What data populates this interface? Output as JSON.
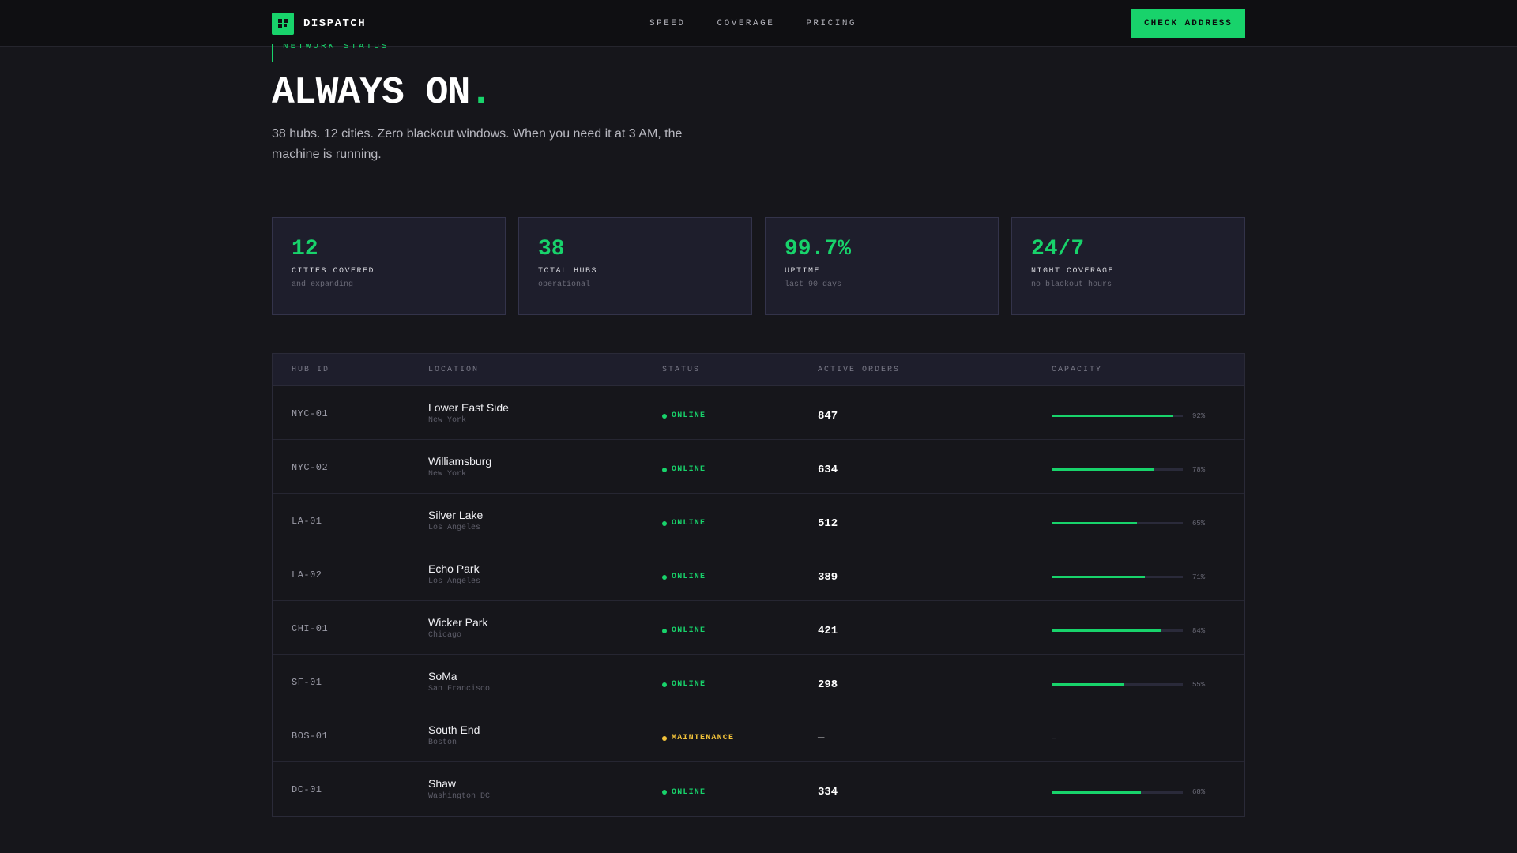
{
  "nav": {
    "brand": "DISPATCH",
    "links": [
      "SPEED",
      "COVERAGE",
      "PRICING"
    ],
    "cta": "CHECK ADDRESS"
  },
  "hero": {
    "eyebrow": "NETWORK STATUS",
    "title": "ALWAYS ON",
    "title_dot": ".",
    "subtitle": "38 hubs. 12 cities. Zero blackout windows. When you need it at 3 AM, the machine is running."
  },
  "stats": [
    {
      "value": "12",
      "label": "CITIES COVERED",
      "sub": "and expanding"
    },
    {
      "value": "38",
      "label": "TOTAL HUBS",
      "sub": "operational"
    },
    {
      "value": "99.7%",
      "label": "UPTIME",
      "sub": "last 90 days"
    },
    {
      "value": "24/7",
      "label": "NIGHT COVERAGE",
      "sub": "no blackout hours"
    }
  ],
  "table": {
    "headers": [
      "HUB ID",
      "LOCATION",
      "STATUS",
      "ACTIVE ORDERS",
      "CAPACITY"
    ],
    "rows": [
      {
        "id": "NYC-01",
        "location": "Lower East Side",
        "city": "New York",
        "status": "ONLINE",
        "orders": "847",
        "capacity": 92,
        "capacity_label": "92%"
      },
      {
        "id": "NYC-02",
        "location": "Williamsburg",
        "city": "New York",
        "status": "ONLINE",
        "orders": "634",
        "capacity": 78,
        "capacity_label": "78%"
      },
      {
        "id": "LA-01",
        "location": "Silver Lake",
        "city": "Los Angeles",
        "status": "ONLINE",
        "orders": "512",
        "capacity": 65,
        "capacity_label": "65%"
      },
      {
        "id": "LA-02",
        "location": "Echo Park",
        "city": "Los Angeles",
        "status": "ONLINE",
        "orders": "389",
        "capacity": 71,
        "capacity_label": "71%"
      },
      {
        "id": "CHI-01",
        "location": "Wicker Park",
        "city": "Chicago",
        "status": "ONLINE",
        "orders": "421",
        "capacity": 84,
        "capacity_label": "84%"
      },
      {
        "id": "SF-01",
        "location": "SoMa",
        "city": "San Francisco",
        "status": "ONLINE",
        "orders": "298",
        "capacity": 55,
        "capacity_label": "55%"
      },
      {
        "id": "BOS-01",
        "location": "South End",
        "city": "Boston",
        "status": "MAINTENANCE",
        "orders": "—",
        "capacity": null,
        "capacity_label": "—"
      },
      {
        "id": "DC-01",
        "location": "Shaw",
        "city": "Washington DC",
        "status": "ONLINE",
        "orders": "334",
        "capacity": 68,
        "capacity_label": "68%"
      }
    ]
  },
  "colors": {
    "accent": "#18d36b",
    "maintenance": "#f2c23a",
    "background": "#16161b",
    "card": "#1e1e2c"
  },
  "icons": {
    "brand": "grid-logo-icon",
    "status": "status-dot-icon"
  }
}
